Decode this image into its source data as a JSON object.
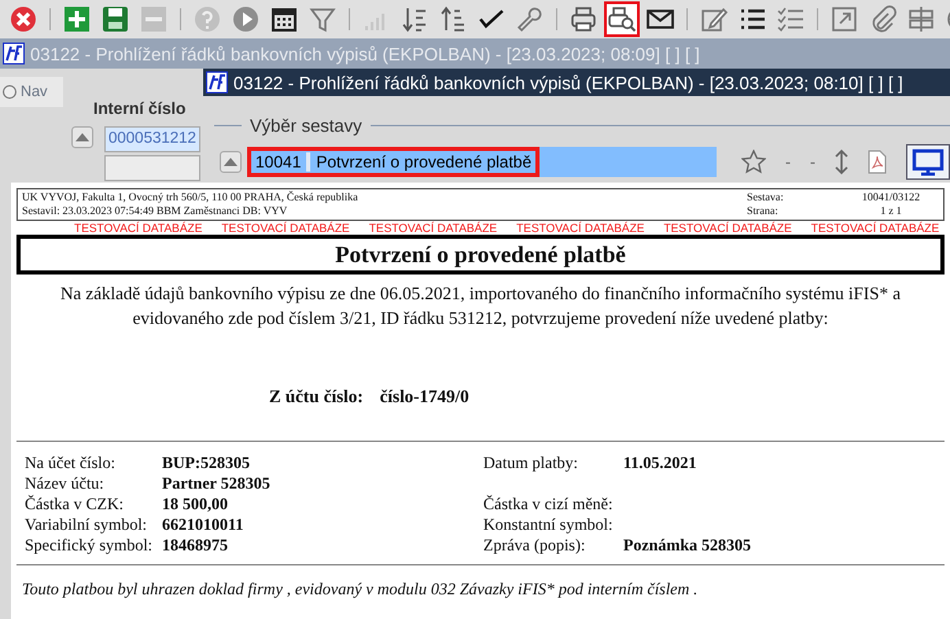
{
  "toolbar": [
    {
      "kind": "close",
      "highlighted": false,
      "disabled": false
    },
    {
      "kind": "sep"
    },
    {
      "kind": "add",
      "highlighted": false,
      "disabled": false
    },
    {
      "kind": "save",
      "highlighted": false,
      "disabled": false
    },
    {
      "kind": "remove",
      "highlighted": false,
      "disabled": true
    },
    {
      "kind": "sep"
    },
    {
      "kind": "help",
      "highlighted": false,
      "disabled": true
    },
    {
      "kind": "play",
      "highlighted": false,
      "disabled": false
    },
    {
      "kind": "calendar",
      "highlighted": false,
      "disabled": false
    },
    {
      "kind": "filter",
      "highlighted": false,
      "disabled": false
    },
    {
      "kind": "sep"
    },
    {
      "kind": "bars",
      "highlighted": false,
      "disabled": true
    },
    {
      "kind": "sortdown",
      "highlighted": false,
      "disabled": false
    },
    {
      "kind": "sortup",
      "highlighted": false,
      "disabled": false
    },
    {
      "kind": "check",
      "disabled": false
    },
    {
      "kind": "wrench",
      "highlighted": false,
      "disabled": false
    },
    {
      "kind": "sep"
    },
    {
      "kind": "print",
      "highlighted": false,
      "disabled": false
    },
    {
      "kind": "preview",
      "highlighted": true,
      "disabled": false
    },
    {
      "kind": "mail",
      "highlighted": false,
      "disabled": false
    },
    {
      "kind": "sep"
    },
    {
      "kind": "edit",
      "highlighted": false,
      "disabled": false
    },
    {
      "kind": "list",
      "highlighted": false,
      "disabled": false
    },
    {
      "kind": "checklist",
      "disabled": false
    },
    {
      "kind": "sep"
    },
    {
      "kind": "external",
      "highlighted": false,
      "disabled": false
    },
    {
      "kind": "clip",
      "highlighted": false,
      "disabled": false
    },
    {
      "kind": "sign",
      "highlighted": false,
      "disabled": false
    },
    {
      "kind": "globe",
      "highlighted": false,
      "disabled": false
    }
  ],
  "back_window": {
    "title": "03122 - Prohlížení řádků bankovních výpisů (EKPOLBAN) - [23.03.2023; 08:09]  [ ]  [ ]"
  },
  "left_panel": {
    "nav_tab": "Nav",
    "field_label": "Interní číslo",
    "field_value": "0000531212"
  },
  "window": {
    "title": "03122 - Prohlížení řádků bankovních výpisů (EKPOLBAN) - [23.03.2023; 08:10]  [ ]  [ ]"
  },
  "report_select": {
    "legend": "Výběr sestavy",
    "item": {
      "code": "10041",
      "name": "Potvrzení o provedené platbě",
      "selected": true
    },
    "dash_1": "-",
    "dash_2": "-",
    "screen_output_on": true
  },
  "report": {
    "org": "UK VYVOJ, Fakulta 1, Ovocný trh 560/5, 110 00 PRAHA, Česká republika",
    "compiled": "Sestavil: 23.03.2023 07:54:49 BBM Zaměstnanci  DB: VYV",
    "meta": [
      {
        "label": "Sestava:",
        "value": "10041/03122"
      },
      {
        "label": "Strana:",
        "value": "1 z 1"
      }
    ],
    "banner": [
      "TESTOVACÍ DATABÁZE",
      "TESTOVACÍ DATABÁZE",
      "TESTOVACÍ DATABÁZE",
      "TESTOVACÍ DATABÁZE",
      "TESTOVACÍ DATABÁZE",
      "TESTOVACÍ DATABÁZE"
    ],
    "title": "Potvrzení o provedené platbě",
    "intro": "Na základě údajů bankovního výpisu ze dne 06.05.2021, importovaného do finančního informačního systému iFIS* a evidovaného zde pod číslem 3/21, ID řádku 531212, potvrzujeme provedení níže uvedené platby:",
    "from_label": "Z účtu číslo:",
    "from_value": "číslo-1749/0",
    "field_rows": [
      {
        "label": "Na účet číslo:",
        "value": "BUP:528305",
        "right_label": "Datum platby:",
        "right_value": "11.05.2021"
      },
      {
        "label": "Název účtu:",
        "value": "Partner 528305"
      },
      {
        "label": "Částka v CZK:",
        "value": "18 500,00",
        "right_label": "Částka v cizí měně:"
      },
      {
        "label": "Variabilní symbol:",
        "value": "6621010011",
        "right_label": "Konstantní symbol:"
      },
      {
        "label": "Specifický symbol:",
        "value": "18468975",
        "right_label": "Zpráva (popis):",
        "right_value": "Poznámka 528305"
      }
    ],
    "note": "Touto platbou byl uhrazen doklad firmy , evidovaný v modulu 032 Závazky iFIS* pod interním číslem ."
  }
}
